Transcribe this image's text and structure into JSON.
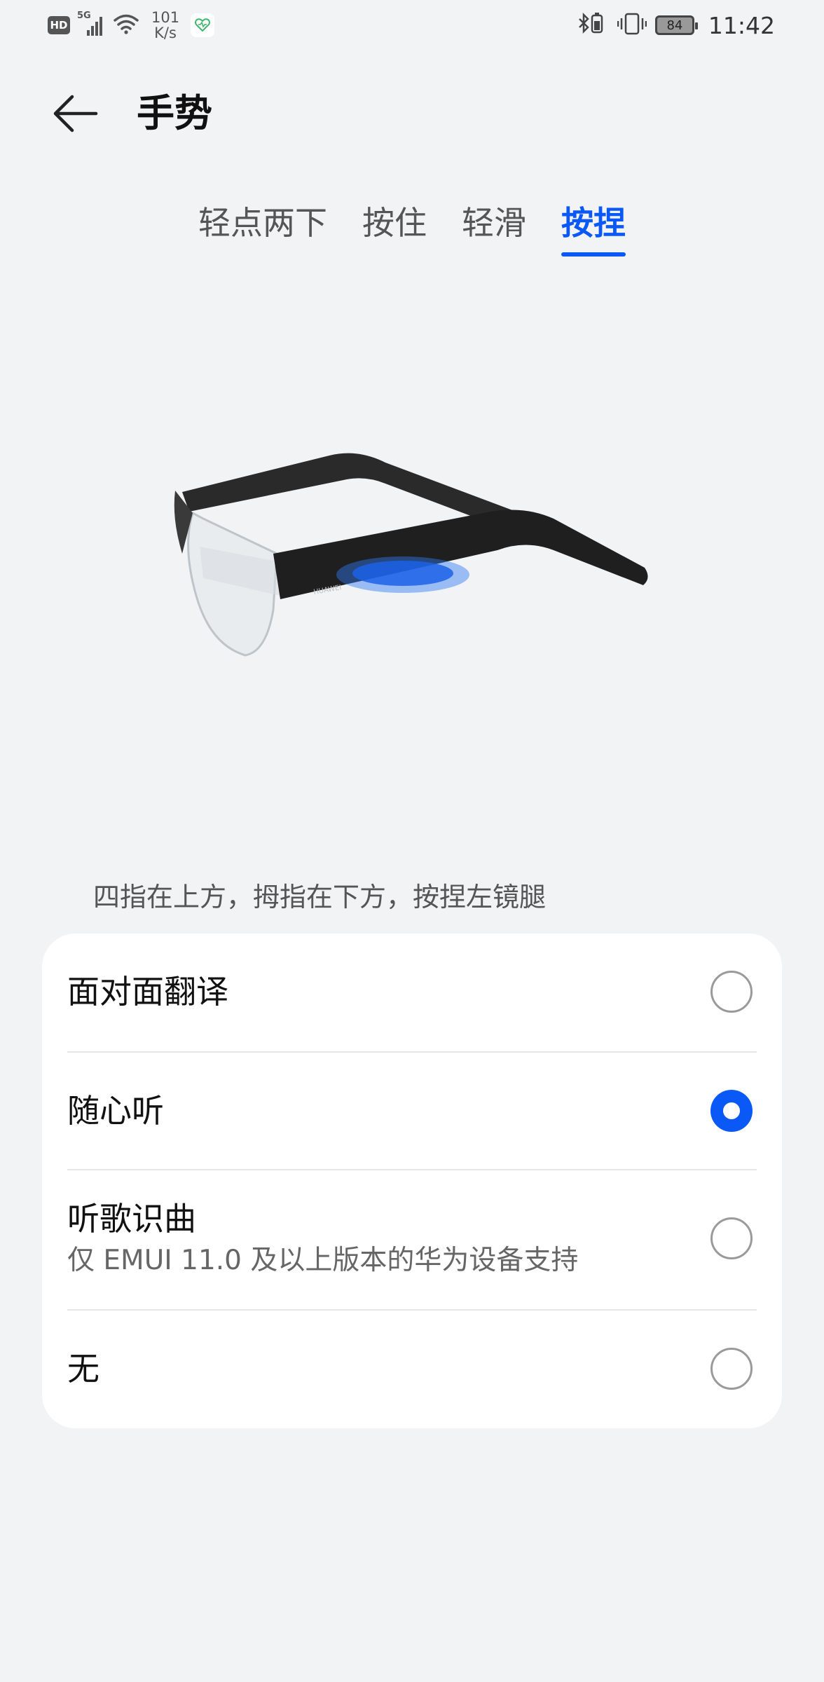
{
  "status_bar": {
    "hd_label": "HD",
    "signal_label": "5G",
    "net_speed_value": "101",
    "net_speed_unit": "K/s",
    "battery_level": "84",
    "time": "11:42"
  },
  "header": {
    "title": "手势"
  },
  "tabs": [
    {
      "label": "轻点两下",
      "active": false
    },
    {
      "label": "按住",
      "active": false
    },
    {
      "label": "轻滑",
      "active": false
    },
    {
      "label": "按捏",
      "active": true
    }
  ],
  "illustration": {
    "brand_text": "HUAWEI"
  },
  "instruction": "四指在上方，拇指在下方，按捏左镜腿",
  "options": [
    {
      "label": "面对面翻译",
      "subtitle": "",
      "selected": false
    },
    {
      "label": "随心听",
      "subtitle": "",
      "selected": true
    },
    {
      "label": "听歌识曲",
      "subtitle": "仅 EMUI 11.0 及以上版本的华为设备支持",
      "selected": false
    },
    {
      "label": "无",
      "subtitle": "",
      "selected": false
    }
  ],
  "colors": {
    "accent": "#0a59f7",
    "background": "#f1f3f5",
    "card": "#ffffff"
  }
}
